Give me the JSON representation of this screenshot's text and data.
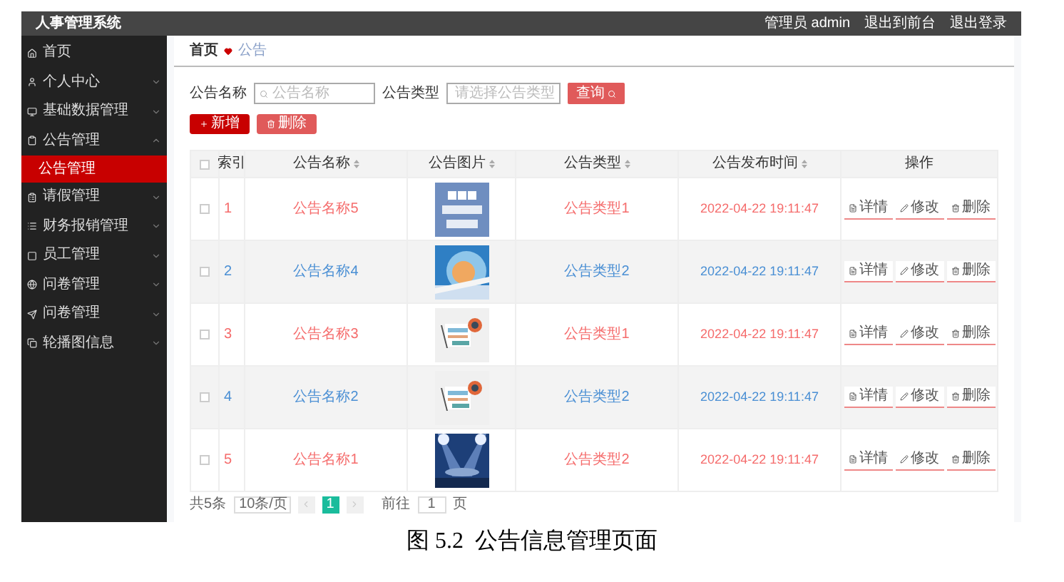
{
  "header": {
    "title": "人事管理系统",
    "links": [
      "管理员 admin",
      "退出到前台",
      "退出登录"
    ]
  },
  "sidebar": {
    "items": [
      {
        "label": "首页"
      },
      {
        "label": "个人中心",
        "expanded": false
      },
      {
        "label": "基础数据管理",
        "expanded": false
      },
      {
        "label": "公告管理",
        "expanded": true,
        "children": [
          {
            "label": "公告管理",
            "selected": true
          }
        ]
      },
      {
        "label": "请假管理",
        "expanded": false
      },
      {
        "label": "财务报销管理",
        "expanded": false
      },
      {
        "label": "员工管理",
        "expanded": false
      },
      {
        "label": "问卷管理",
        "expanded": false
      },
      {
        "label": "问卷管理",
        "expanded": false
      },
      {
        "label": "轮播图信息",
        "expanded": false
      }
    ]
  },
  "breadcrumb": [
    "首页",
    "公告"
  ],
  "search": {
    "fields": [
      {
        "kind": "text",
        "label": "公告名称",
        "placeholder": "公告名称"
      },
      {
        "kind": "select",
        "label": "公告类型",
        "placeholder": "请选择公告类型"
      }
    ],
    "button": "查询"
  },
  "actions": [
    "新增",
    "删除"
  ],
  "table": {
    "select_all": {
      "checked": false
    },
    "columns": [
      {
        "label": "索引",
        "sortable": false
      },
      {
        "label": "公告名称",
        "sortable": true
      },
      {
        "label": "公告图片",
        "sortable": true
      },
      {
        "label": "公告类型",
        "sortable": true
      },
      {
        "label": "公告发布时间",
        "sortable": true
      },
      {
        "label": "操作",
        "sortable": false
      }
    ],
    "rows": [
      {
        "checked": false,
        "striped": false,
        "color": "#f56c6c",
        "index": "1",
        "name": "公告名称5",
        "type": "公告类型1",
        "time": "2022-04-22 19:11:47",
        "buttons": [
          "详情",
          "修改",
          "删除"
        ]
      },
      {
        "checked": false,
        "striped": true,
        "color": "#4a8fd4",
        "index": "2",
        "name": "公告名称4",
        "type": "公告类型2",
        "time": "2022-04-22 19:11:47",
        "buttons": [
          "详情",
          "修改",
          "删除"
        ]
      },
      {
        "checked": false,
        "striped": false,
        "color": "#f56c6c",
        "index": "3",
        "name": "公告名称3",
        "type": "公告类型1",
        "time": "2022-04-22 19:11:47",
        "buttons": [
          "详情",
          "修改",
          "删除"
        ]
      },
      {
        "checked": false,
        "striped": true,
        "color": "#4a8fd4",
        "index": "4",
        "name": "公告名称2",
        "type": "公告类型2",
        "time": "2022-04-22 19:11:47",
        "buttons": [
          "详情",
          "修改",
          "删除"
        ]
      },
      {
        "checked": false,
        "striped": false,
        "color": "#f56c6c",
        "index": "5",
        "name": "公告名称1",
        "type": "公告类型2",
        "time": "2022-04-22 19:11:47",
        "buttons": [
          "详情",
          "修改",
          "删除"
        ]
      }
    ]
  },
  "pagination": {
    "total": "共5条",
    "page_size": "10条/页",
    "pages": [
      {
        "label": "1",
        "selected": true
      }
    ],
    "prev_disabled": true,
    "next_disabled": true,
    "goto_label": "前往",
    "goto_value": "1",
    "goto_suffix": "页"
  },
  "caption": "图 5.2  公告信息管理页面"
}
